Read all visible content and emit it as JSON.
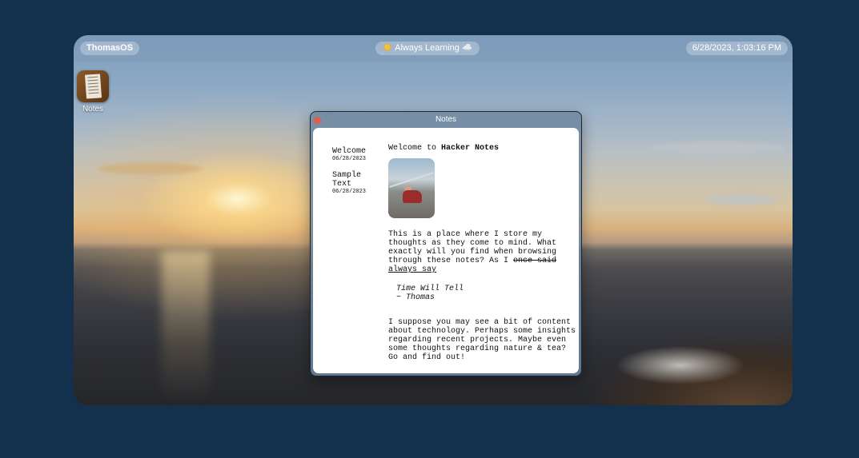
{
  "os": {
    "brand": "ThomasOS",
    "status": "☀️ Always Learning ☁️",
    "clock": "6/28/2023, 1:03:16 PM"
  },
  "desktop": {
    "icons": [
      {
        "label": "Notes",
        "icon": "notes-app-icon"
      }
    ]
  },
  "window": {
    "title": "Notes",
    "notes": [
      {
        "title": "Welcome",
        "date": "06/28/2023"
      },
      {
        "title": "Sample Text",
        "date": "06/28/2023"
      }
    ],
    "active_note": {
      "heading_prefix": "Welcome to ",
      "heading_bold": "Hacker Notes",
      "paragraph1": "This is a place where I store my thoughts as they come to mind. What exactly will you find when browsing through these notes? As I ",
      "struck": "once said",
      "underlined": "always say",
      "quote_line1": "Time Will Tell",
      "quote_line2": "~ Thomas",
      "paragraph2": "I suppose you may see a bit of content about technology. Perhaps some insights regarding recent projects. Maybe even some thoughts regarding nature & tea? Go and find out!"
    }
  },
  "colors": {
    "page_bg": "#13304d",
    "close_button": "#e25b4b"
  }
}
